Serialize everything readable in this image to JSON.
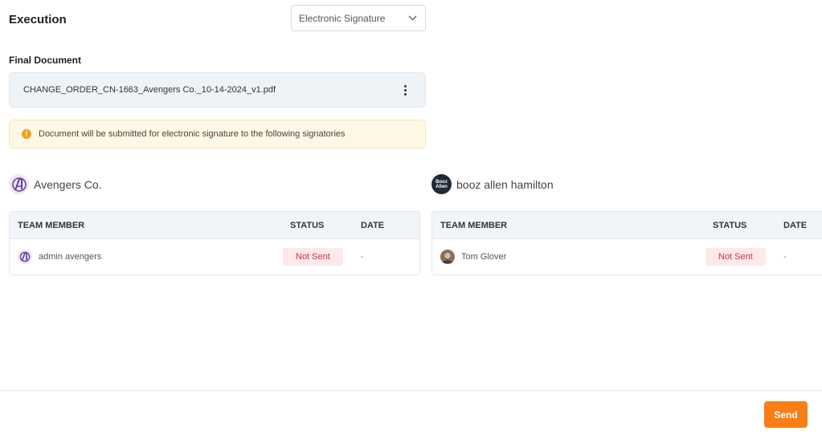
{
  "header": {
    "title": "Execution"
  },
  "signature_method": {
    "selected": "Electronic Signature"
  },
  "final_document": {
    "label": "Final Document",
    "file_name": "CHANGE_ORDER_CN-1663_Avengers Co._10-14-2024_v1.pdf"
  },
  "notice": {
    "text": "Document will be submitted for electronic signature to the following signatories"
  },
  "columns": {
    "member": "TEAM MEMBER",
    "status": "STATUS",
    "date": "DATE"
  },
  "parties": [
    {
      "name": "Avengers Co.",
      "members": [
        {
          "name": "admin avengers",
          "status": "Not Sent",
          "date": "-"
        }
      ]
    },
    {
      "name": "booz allen hamilton",
      "logo_text": [
        "Booz",
        "Allen"
      ],
      "members": [
        {
          "name": "Tom Glover",
          "status": "Not Sent",
          "date": "-"
        }
      ]
    }
  ],
  "footer": {
    "send_label": "Send"
  },
  "colors": {
    "accent": "#fb7d15",
    "status_text": "#d62e3c",
    "status_bg": "#fde8ea",
    "notice_bg": "#fdf8e4",
    "warning": "#f0a020"
  },
  "icons": {
    "select_arrow": "chevron-down-icon",
    "doc_menu": "kebab-menu-icon",
    "notice": "warning-icon"
  }
}
